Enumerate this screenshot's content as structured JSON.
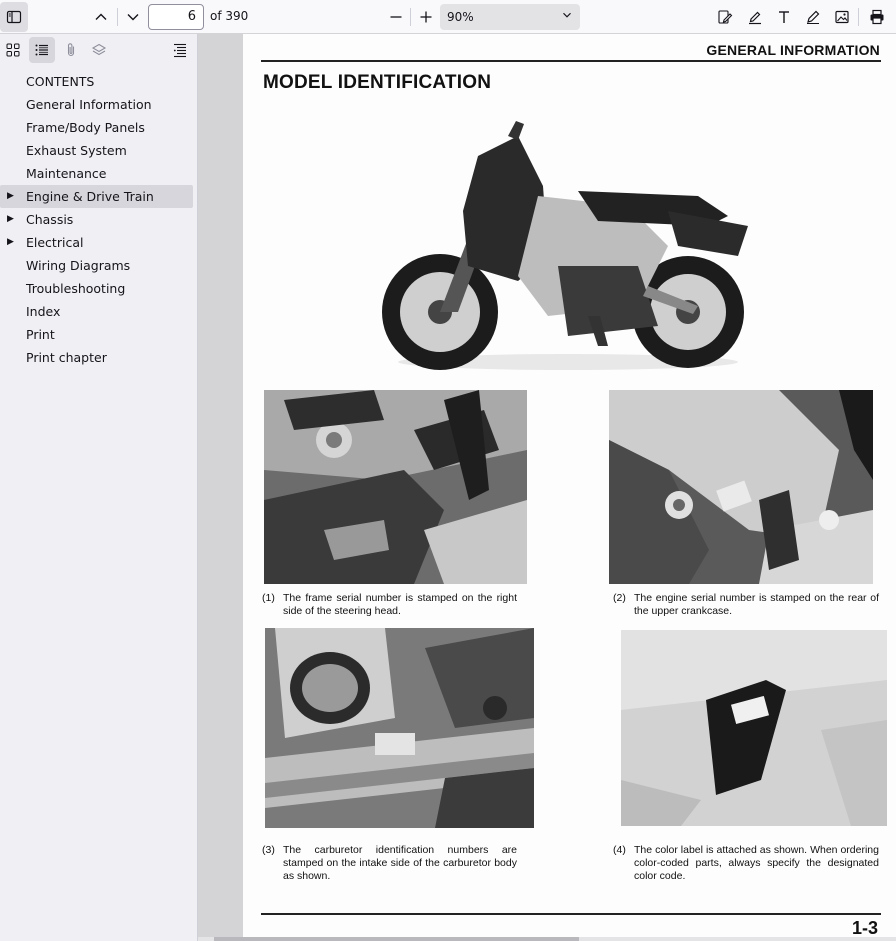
{
  "toolbar": {
    "page_number": "6",
    "page_count": "of 390",
    "zoom_value": "90%"
  },
  "sidebar": {
    "outline": [
      {
        "label": "CONTENTS",
        "expandable": false
      },
      {
        "label": "General Information",
        "expandable": false
      },
      {
        "label": "Frame/Body Panels",
        "expandable": false
      },
      {
        "label": "Exhaust System",
        "expandable": false
      },
      {
        "label": "Maintenance",
        "expandable": false
      },
      {
        "label": "Engine & Drive Train",
        "expandable": true,
        "selected": true
      },
      {
        "label": "Chassis",
        "expandable": true
      },
      {
        "label": "Electrical",
        "expandable": true
      },
      {
        "label": "Wiring Diagrams",
        "expandable": false
      },
      {
        "label": "Troubleshooting",
        "expandable": false
      },
      {
        "label": "Index",
        "expandable": false
      },
      {
        "label": "Print",
        "expandable": false
      },
      {
        "label": "Print chapter",
        "expandable": false
      }
    ]
  },
  "document": {
    "header": "GENERAL INFORMATION",
    "title": "MODEL IDENTIFICATION",
    "captions": [
      {
        "num": "(1)",
        "text": "The frame serial number is stamped on the right side of the steering head."
      },
      {
        "num": "(2)",
        "text": "The engine serial number is stamped on the rear of the upper crankcase."
      },
      {
        "num": "(3)",
        "text": "The carburetor identification numbers are stamped on the intake side of the carburetor body as shown."
      },
      {
        "num": "(4)",
        "text": "The color label is attached as shown. When ordering color-coded parts, always specify the designated color code."
      }
    ],
    "page_number": "1-3"
  }
}
